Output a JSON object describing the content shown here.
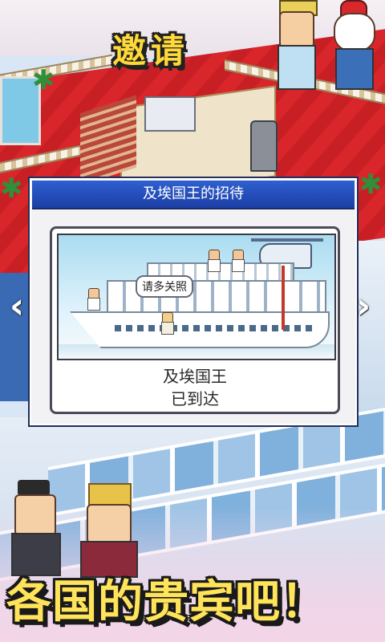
{
  "screen": {
    "headline": "邀请",
    "footer_text": "各国的贵宾吧！"
  },
  "dialog": {
    "title": "及埃国王的招待",
    "speech_bubble": "请多关照",
    "caption_line1": "及埃国王",
    "caption_line2": "已到达"
  },
  "navigation": {
    "prev_glyph": "‹",
    "next_glyph": "›"
  },
  "icons": {
    "prev": "chevron-left-icon",
    "next": "chevron-right-icon"
  },
  "colors": {
    "dialog_header": "#2f5fd0",
    "headline_text": "#ffd93a",
    "footer_text": "#ffe45a",
    "deck_red": "#d8262b"
  }
}
